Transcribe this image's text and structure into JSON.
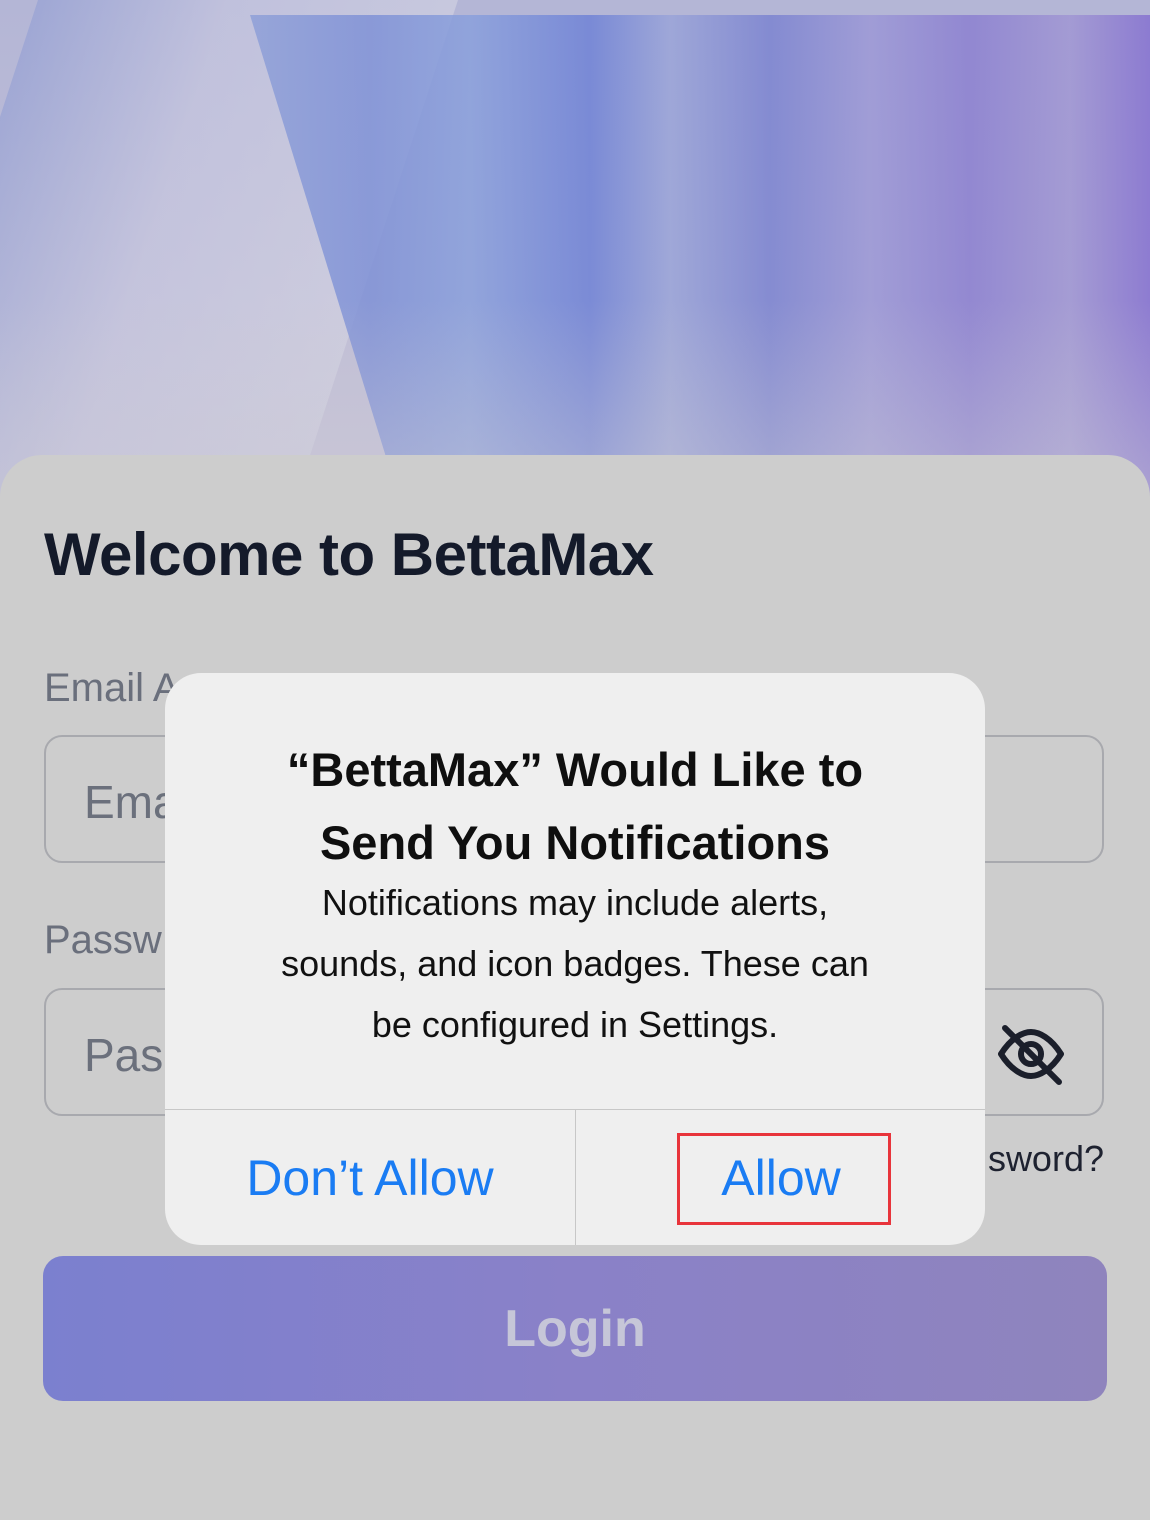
{
  "login": {
    "welcome_title": "Welcome to BettaMax",
    "email_label": "Email A",
    "email_placeholder": "Ema",
    "password_label": "Passw",
    "password_placeholder": "Pas",
    "forgot_password": "sword?",
    "login_button": "Login"
  },
  "alert": {
    "title_line1": "“BettaMax” Would Like to",
    "title_line2": "Send You Notifications",
    "message_line1": "Notifications may include alerts,",
    "message_line2": "sounds, and icon badges. These can",
    "message_line3": "be configured in Settings.",
    "dont_allow": "Don’t Allow",
    "allow": "Allow"
  },
  "icons": {
    "password_visibility": "eye-off-icon"
  },
  "colors": {
    "action_blue": "#1a7cf3",
    "highlight_red": "#e8343b",
    "login_gradient_start": "#7b80cf",
    "login_gradient_end": "#8f84bd"
  }
}
